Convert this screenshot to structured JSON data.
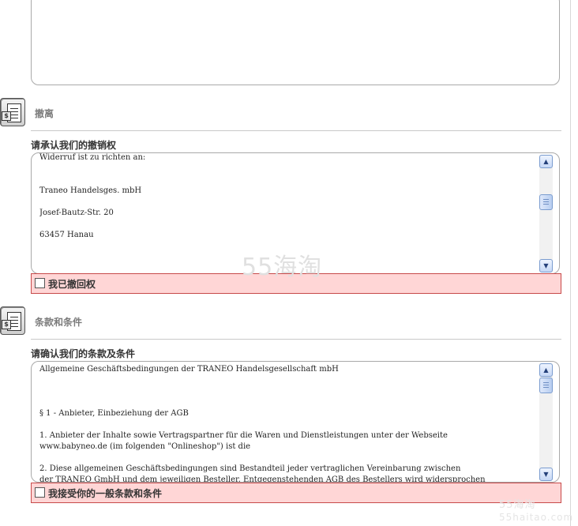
{
  "withdrawal_section": {
    "title": "撤离",
    "label": "请承认我们的撤销权",
    "text_lines": [
      "Widerruf ist zu richten an:",
      "Traneo Handelsges. mbH",
      "Josef-Bautz-Str. 20",
      "63457 Hanau"
    ],
    "checkbox_label": "我已撤回权"
  },
  "terms_section": {
    "title": "条款和条件",
    "label": "请确认我们的条款及条件",
    "text_lines": [
      "Allgemeine Geschäftsbedingungen der TRANEO Handelsgesellschaft mbH",
      "§ 1 - Anbieter, Einbeziehung der AGB",
      "1.  Anbieter der Inhalte sowie Vertragspartner für die Waren und  Dienstleistungen unter der Webseite",
      "www.babyneo.de (im folgenden  \"Onlineshop\") ist die",
      "2.  Diese allgemeinen Geschäftsbedingungen sind Bestandteil jeder  vertraglichen Vereinbarung zwischen",
      "der TRANEO GmbH und dem jeweiligen  Besteller. Entgegenstehenden AGB des Bestellers wird widersprochen"
    ],
    "checkbox_label": "我接受你的一般条款和条件"
  },
  "icons": {
    "section_icon": "document-with-dollar-icon",
    "scroll_up": "▲",
    "scroll_down": "▼"
  },
  "watermark": {
    "main": "55海淘",
    "corner_top": "55海淘",
    "corner_bottom": "55haitao.com"
  },
  "colors": {
    "checkbox_row_bg": "#ffd6d6",
    "checkbox_row_border": "#c74a4a",
    "section_title": "#7b7b7b"
  }
}
